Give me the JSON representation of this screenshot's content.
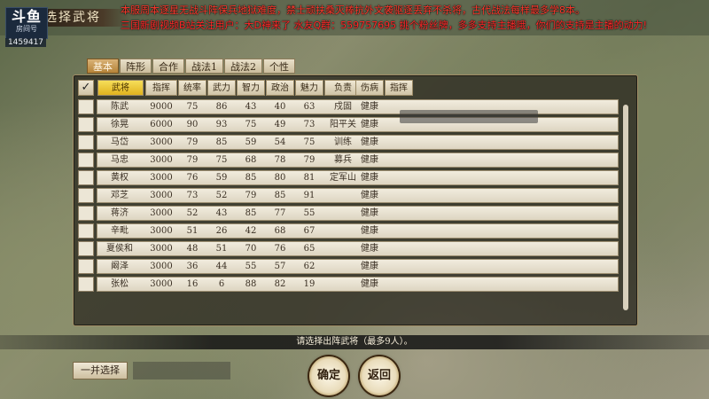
{
  "stream": {
    "logo_main": "斗鱼",
    "logo_sub": "房间号",
    "room_id": "1459417",
    "marquee_line1": "本服周本逐星无战斗阵保兵地狱难度，禁士顽扶桑灭棒抗外文袭驱逐丢弃不杀将，古代战法每样最多学8本。",
    "marquee_line2": "三国新剧视频B站关注用户：大D神来了  水友Q群：559757695  挑个粉丝牌，多多支持主播哦，你们的支持是主播的动力!"
  },
  "page_title": "选择武将",
  "tabs": [
    {
      "label": "基本",
      "active": true
    },
    {
      "label": "阵形",
      "active": false
    },
    {
      "label": "合作",
      "active": false
    },
    {
      "label": "战法1",
      "active": false
    },
    {
      "label": "战法2",
      "active": false
    },
    {
      "label": "个性",
      "active": false
    }
  ],
  "table": {
    "check_mark": "✓",
    "columns": [
      "武将",
      "指挥",
      "统率",
      "武力",
      "智力",
      "政治",
      "魅力",
      "负责",
      "伤病",
      "指挥"
    ],
    "rows": [
      [
        "陈武",
        "9000",
        "75",
        "86",
        "43",
        "40",
        "63",
        "戍固",
        "健康"
      ],
      [
        "徐晃",
        "6000",
        "90",
        "93",
        "75",
        "49",
        "73",
        "阳平关",
        "健康"
      ],
      [
        "马岱",
        "3000",
        "79",
        "85",
        "59",
        "54",
        "75",
        "训练",
        "健康"
      ],
      [
        "马忠",
        "3000",
        "79",
        "75",
        "68",
        "78",
        "79",
        "募兵",
        "健康"
      ],
      [
        "黄权",
        "3000",
        "76",
        "59",
        "85",
        "80",
        "81",
        "定军山",
        "健康"
      ],
      [
        "邓芝",
        "3000",
        "73",
        "52",
        "79",
        "85",
        "91",
        "",
        "健康"
      ],
      [
        "蒋济",
        "3000",
        "52",
        "43",
        "85",
        "77",
        "55",
        "",
        "健康"
      ],
      [
        "辛毗",
        "3000",
        "51",
        "26",
        "42",
        "68",
        "67",
        "",
        "健康"
      ],
      [
        "夏侯和",
        "3000",
        "48",
        "51",
        "70",
        "76",
        "65",
        "",
        "健康"
      ],
      [
        "阚泽",
        "3000",
        "36",
        "44",
        "55",
        "57",
        "62",
        "",
        "健康"
      ],
      [
        "张松",
        "3000",
        "16",
        "6",
        "88",
        "82",
        "19",
        "",
        "健康"
      ]
    ]
  },
  "status_text": "请选择出阵武将（最多9人）。",
  "buttons": {
    "select_all": "一并选择",
    "confirm": "确定",
    "back": "返回"
  }
}
